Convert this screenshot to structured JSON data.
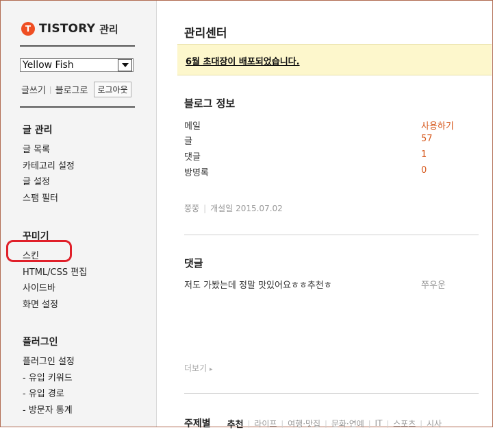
{
  "sidebar": {
    "logo_text": "TISTORY",
    "logo_sub": "관리",
    "blog_select_value": "Yellow Fish",
    "quick_links": [
      "글쓰기",
      "블로그로"
    ],
    "logout_label": "로그아웃",
    "sections": [
      {
        "title": "글 관리",
        "items": [
          "글 목록",
          "카테고리 설정",
          "글 설정",
          "스팸 필터"
        ]
      },
      {
        "title": "꾸미기",
        "items": [
          "스킨",
          "HTML/CSS 편집",
          "사이드바",
          "화면 설정"
        ]
      },
      {
        "title": "플러그인",
        "items": [
          "플러그인 설정",
          "- 유입 키워드",
          "- 유입 경로",
          "- 방문자 통계"
        ]
      }
    ]
  },
  "main": {
    "title": "관리센터",
    "notice": "6월 초대장이 배포되었습니다.",
    "blog_info": {
      "title": "블로그 정보",
      "rows": [
        {
          "label": "메일",
          "value": "사용하기"
        },
        {
          "label": "글",
          "value": "57"
        },
        {
          "label": "댓글",
          "value": "1"
        },
        {
          "label": "방명록",
          "value": "0"
        }
      ],
      "meta_owner": "쭝쭝",
      "meta_created": "개설일 2015.07.02"
    },
    "comments": {
      "title": "댓글",
      "items": [
        {
          "text": "저도 가봤는데 정말 맛있어요ㅎㅎ추천ㅎ",
          "author": "쭈우운"
        }
      ],
      "more_label": "더보기"
    },
    "topics": {
      "label": "주제별",
      "tabs": [
        "추천",
        "라이프",
        "여행·맛집",
        "문화·연예",
        "IT",
        "스포츠",
        "시사"
      ]
    }
  },
  "colors": {
    "accent": "#d6581c",
    "logo": "#ef4e22",
    "highlight": "#e0202a",
    "notice_bg": "#fdf7cc"
  },
  "icons": {
    "logo": "tistory-t-logo-icon",
    "select_arrow": "chevron-down-icon",
    "more_arrow": "chevron-right-icon"
  }
}
